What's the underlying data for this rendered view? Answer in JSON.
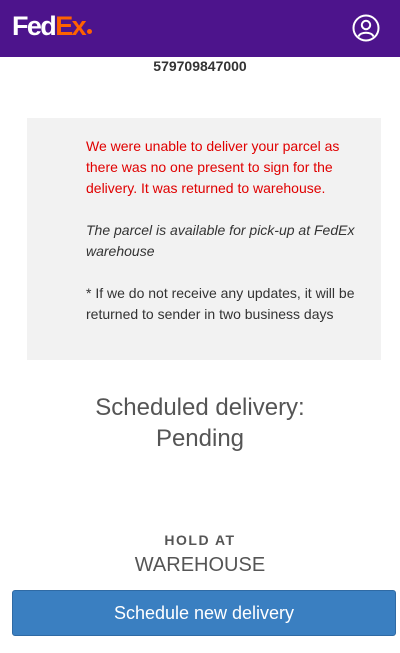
{
  "header": {
    "logo_fed": "Fed",
    "logo_ex": "Ex",
    "logo_icon": "fedex-logo",
    "account_icon": "user-account-icon",
    "background_color": "#4d148c",
    "accent_color": "#ff6200"
  },
  "shipment": {
    "tracking_number": "579709847000"
  },
  "notice": {
    "warning": "We were unable to deliver your parcel as there was no one present to sign for the delivery. It was returned to warehouse.",
    "pickup": "The parcel is available for pick-up at FedEx warehouse",
    "updates": "* If we do not receive any updates, it will be returned to sender in two business days",
    "warning_color": "#e00000"
  },
  "delivery": {
    "scheduled_label": "Scheduled delivery:",
    "scheduled_value": "Pending"
  },
  "hold": {
    "label": "HOLD AT",
    "value": "WAREHOUSE"
  },
  "actions": {
    "schedule_button": "Schedule new delivery",
    "button_color": "#3a7fc1"
  }
}
